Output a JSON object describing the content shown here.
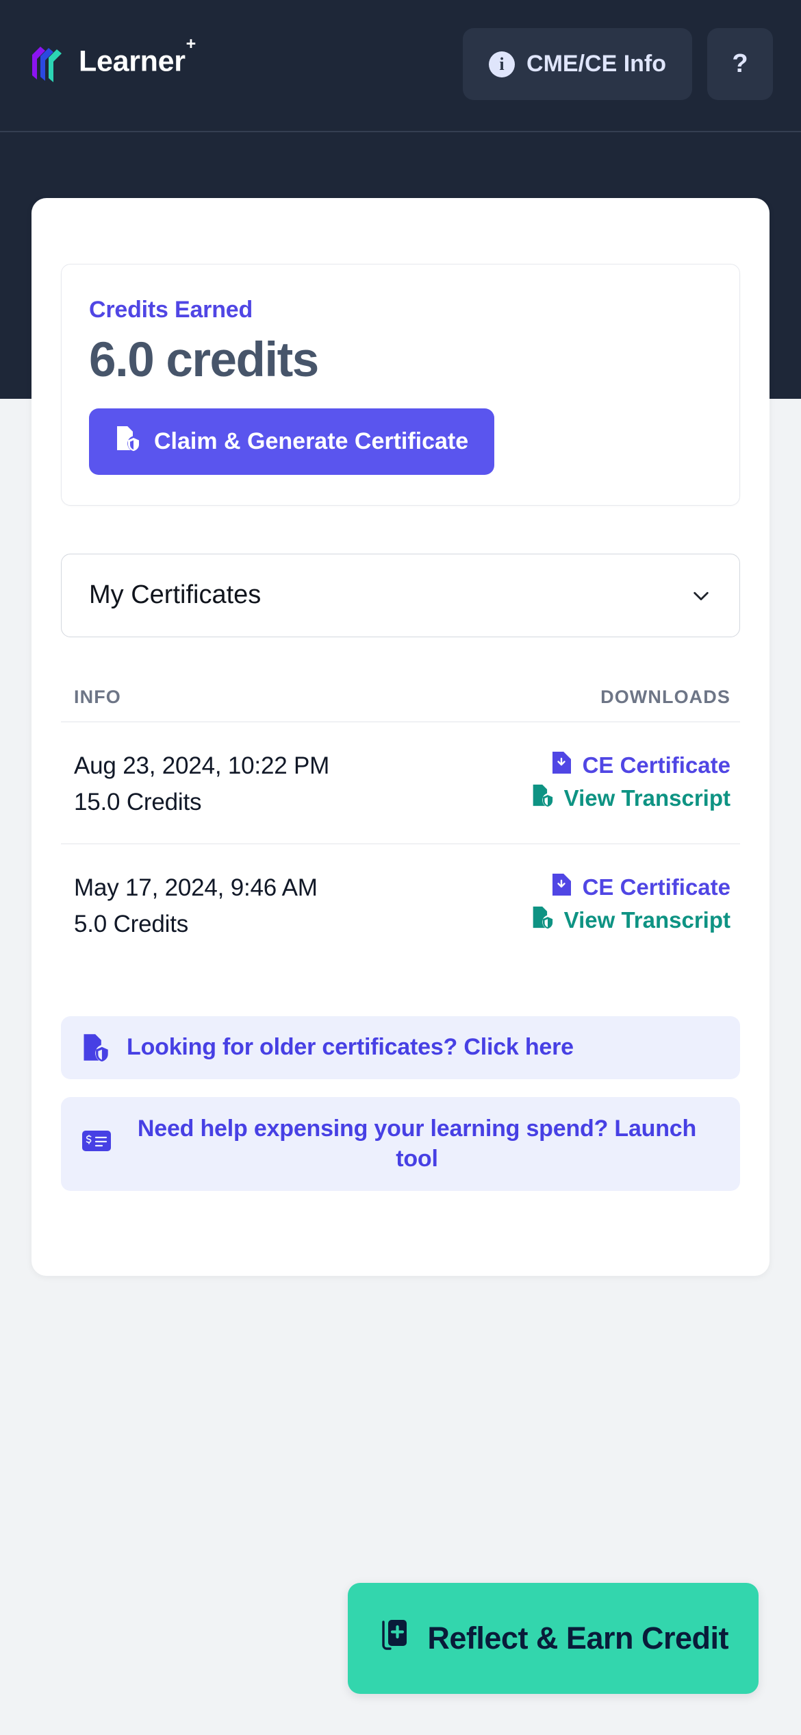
{
  "header": {
    "brand_name": "Learner",
    "brand_superscript": "+",
    "info_button_label": "CME/CE Info",
    "info_icon_glyph": "i",
    "help_button_label": "?",
    "background_color": "#1e2738",
    "button_color": "#2a3447"
  },
  "credits_card": {
    "label": "Credits Earned",
    "value": "6.0 credits",
    "claim_button_label": "Claim & Generate Certificate",
    "accent_color": "#5046e4",
    "button_color": "#5a55ee"
  },
  "certificates_select": {
    "selected": "My Certificates",
    "options": [
      "My Certificates"
    ]
  },
  "table": {
    "columns": [
      "INFO",
      "DOWNLOADS"
    ],
    "rows": [
      {
        "date": "Aug 23, 2024, 10:22 PM",
        "credits": "15.0 Credits",
        "certificate_link": "CE Certificate",
        "transcript_link": "View Transcript"
      },
      {
        "date": "May 17, 2024, 9:46 AM",
        "credits": "5.0 Credits",
        "certificate_link": "CE Certificate",
        "transcript_link": "View Transcript"
      }
    ],
    "certificate_link_color": "#5046e4",
    "transcript_link_color": "#0e9383"
  },
  "promos": [
    {
      "text": "Looking for older certificates? Click here"
    },
    {
      "text": "Need help expensing your learning spend? Launch tool"
    }
  ],
  "cta": {
    "label": "Reflect & Earn Credit",
    "background_color": "#33d6ad",
    "text_color": "#091b39"
  }
}
